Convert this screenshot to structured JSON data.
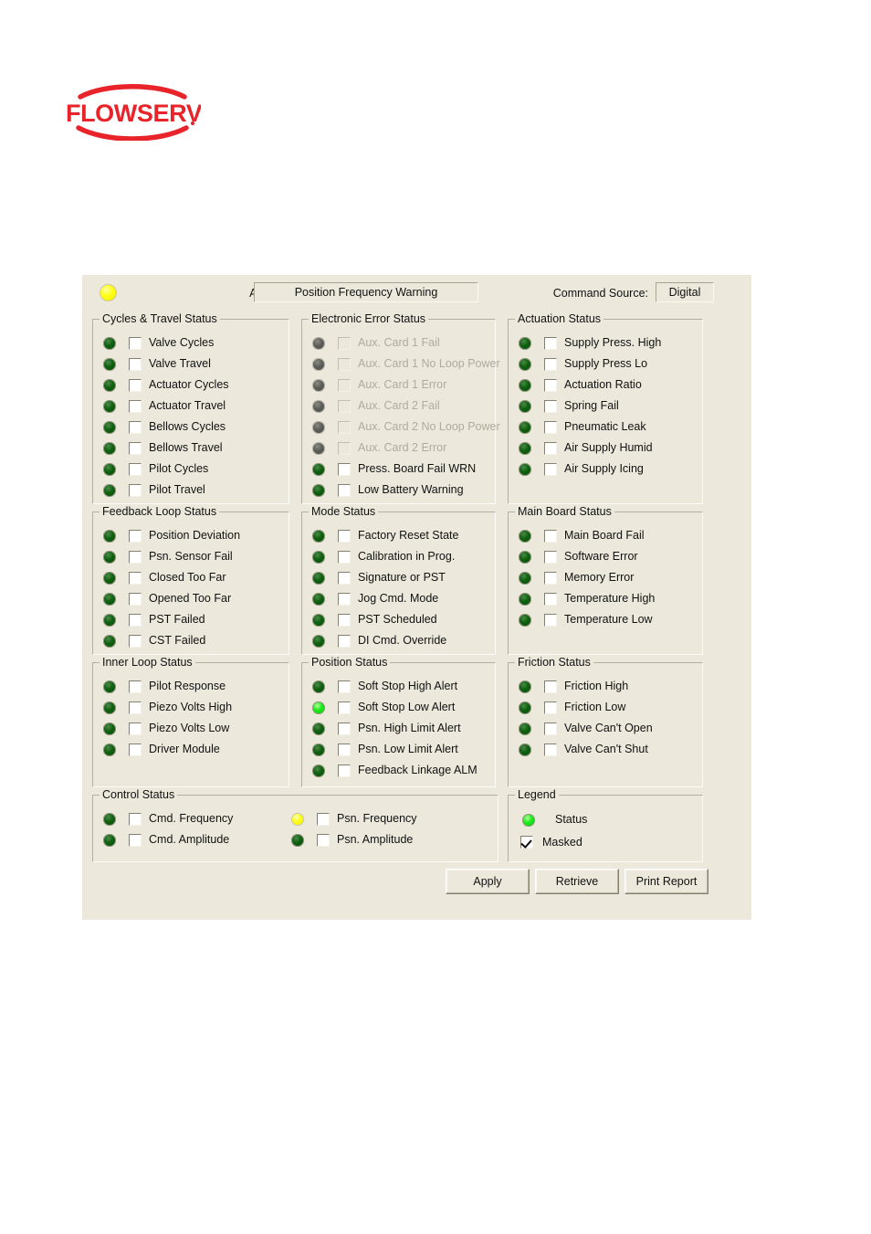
{
  "brand": {
    "name": "FLOWSERVE",
    "color": "#e8232a"
  },
  "header": {
    "active_indicator_label": "Active Indicator:",
    "active_indicator_value": "Position Frequency Warning",
    "command_source_label": "Command Source:",
    "command_source_value": "Digital"
  },
  "legend_colors": {
    "led_off": "#0f6010",
    "led_on": "#1bea1b",
    "led_warning": "#ffff14",
    "led_disabled": "#5c5c58",
    "panel_background": "#ece8dc"
  },
  "groups": [
    {
      "id": "cycles-travel-status",
      "title": "Cycles & Travel Status",
      "items": [
        {
          "label": "Valve Cycles",
          "led": "off",
          "checked": false,
          "disabled": false
        },
        {
          "label": "Valve Travel",
          "led": "off",
          "checked": false,
          "disabled": false
        },
        {
          "label": "Actuator Cycles",
          "led": "off",
          "checked": false,
          "disabled": false
        },
        {
          "label": "Actuator Travel",
          "led": "off",
          "checked": false,
          "disabled": false
        },
        {
          "label": "Bellows Cycles",
          "led": "off",
          "checked": false,
          "disabled": false
        },
        {
          "label": "Bellows Travel",
          "led": "off",
          "checked": false,
          "disabled": false
        },
        {
          "label": "Pilot Cycles",
          "led": "off",
          "checked": false,
          "disabled": false
        },
        {
          "label": "Pilot Travel",
          "led": "off",
          "checked": false,
          "disabled": false
        }
      ]
    },
    {
      "id": "electronic-error-status",
      "title": "Electronic Error Status",
      "items": [
        {
          "label": "Aux. Card 1 Fail",
          "led": "dis",
          "checked": false,
          "disabled": true
        },
        {
          "label": "Aux. Card 1 No Loop Power",
          "led": "dis",
          "checked": false,
          "disabled": true
        },
        {
          "label": "Aux. Card 1 Error",
          "led": "dis",
          "checked": false,
          "disabled": true
        },
        {
          "label": "Aux. Card 2 Fail",
          "led": "dis",
          "checked": false,
          "disabled": true
        },
        {
          "label": "Aux. Card 2 No Loop Power",
          "led": "dis",
          "checked": false,
          "disabled": true
        },
        {
          "label": "Aux. Card 2 Error",
          "led": "dis",
          "checked": false,
          "disabled": true
        },
        {
          "label": "Press. Board Fail WRN",
          "led": "off",
          "checked": false,
          "disabled": false
        },
        {
          "label": "Low Battery Warning",
          "led": "off",
          "checked": false,
          "disabled": false
        }
      ]
    },
    {
      "id": "actuation-status",
      "title": "Actuation Status",
      "items": [
        {
          "label": "Supply Press. High",
          "led": "off",
          "checked": false,
          "disabled": false
        },
        {
          "label": "Supply Press Lo",
          "led": "off",
          "checked": false,
          "disabled": false
        },
        {
          "label": "Actuation Ratio",
          "led": "off",
          "checked": false,
          "disabled": false
        },
        {
          "label": "Spring Fail",
          "led": "off",
          "checked": false,
          "disabled": false
        },
        {
          "label": "Pneumatic Leak",
          "led": "off",
          "checked": false,
          "disabled": false
        },
        {
          "label": "Air Supply Humid",
          "led": "off",
          "checked": false,
          "disabled": false
        },
        {
          "label": "Air Supply Icing",
          "led": "off",
          "checked": false,
          "disabled": false
        }
      ]
    },
    {
      "id": "feedback-loop-status",
      "title": "Feedback Loop Status",
      "items": [
        {
          "label": "Position Deviation",
          "led": "off",
          "checked": false,
          "disabled": false
        },
        {
          "label": "Psn. Sensor Fail",
          "led": "off",
          "checked": false,
          "disabled": false
        },
        {
          "label": "Closed Too Far",
          "led": "off",
          "checked": false,
          "disabled": false
        },
        {
          "label": "Opened Too Far",
          "led": "off",
          "checked": false,
          "disabled": false
        },
        {
          "label": "PST Failed",
          "led": "off",
          "checked": false,
          "disabled": false
        },
        {
          "label": "CST Failed",
          "led": "off",
          "checked": false,
          "disabled": false
        }
      ]
    },
    {
      "id": "mode-status",
      "title": "Mode Status",
      "items": [
        {
          "label": "Factory Reset State",
          "led": "off",
          "checked": false,
          "disabled": false
        },
        {
          "label": "Calibration in Prog.",
          "led": "off",
          "checked": false,
          "disabled": false
        },
        {
          "label": "Signature or PST",
          "led": "off",
          "checked": false,
          "disabled": false
        },
        {
          "label": "Jog Cmd. Mode",
          "led": "off",
          "checked": false,
          "disabled": false
        },
        {
          "label": "PST Scheduled",
          "led": "off",
          "checked": false,
          "disabled": false
        },
        {
          "label": "DI Cmd. Override",
          "led": "off",
          "checked": false,
          "disabled": false
        }
      ]
    },
    {
      "id": "main-board-status",
      "title": "Main Board Status",
      "items": [
        {
          "label": "Main Board Fail",
          "led": "off",
          "checked": false,
          "disabled": false
        },
        {
          "label": "Software Error",
          "led": "off",
          "checked": false,
          "disabled": false
        },
        {
          "label": "Memory Error",
          "led": "off",
          "checked": false,
          "disabled": false
        },
        {
          "label": "Temperature High",
          "led": "off",
          "checked": false,
          "disabled": false
        },
        {
          "label": "Temperature Low",
          "led": "off",
          "checked": false,
          "disabled": false
        }
      ]
    },
    {
      "id": "inner-loop-status",
      "title": "Inner Loop Status",
      "items": [
        {
          "label": "Pilot Response",
          "led": "off",
          "checked": false,
          "disabled": false
        },
        {
          "label": "Piezo Volts High",
          "led": "off",
          "checked": false,
          "disabled": false
        },
        {
          "label": "Piezo Volts Low",
          "led": "off",
          "checked": false,
          "disabled": false
        },
        {
          "label": "Driver Module",
          "led": "off",
          "checked": false,
          "disabled": false
        }
      ]
    },
    {
      "id": "position-status",
      "title": "Position Status",
      "items": [
        {
          "label": "Soft Stop High Alert",
          "led": "off",
          "checked": false,
          "disabled": false
        },
        {
          "label": "Soft Stop Low Alert",
          "led": "on",
          "checked": false,
          "disabled": false
        },
        {
          "label": "Psn. High Limit Alert",
          "led": "off",
          "checked": false,
          "disabled": false
        },
        {
          "label": "Psn. Low Limit Alert",
          "led": "off",
          "checked": false,
          "disabled": false
        },
        {
          "label": "Feedback Linkage ALM",
          "led": "off",
          "checked": false,
          "disabled": false
        }
      ]
    },
    {
      "id": "friction-status",
      "title": "Friction Status",
      "items": [
        {
          "label": "Friction High",
          "led": "off",
          "checked": false,
          "disabled": false
        },
        {
          "label": "Friction Low",
          "led": "off",
          "checked": false,
          "disabled": false
        },
        {
          "label": "Valve Can't Open",
          "led": "off",
          "checked": false,
          "disabled": false
        },
        {
          "label": "Valve Can't Shut",
          "led": "off",
          "checked": false,
          "disabled": false
        }
      ]
    }
  ],
  "control_status": {
    "id": "control-status",
    "title": "Control Status",
    "left_items": [
      {
        "label": "Cmd. Frequency",
        "led": "off",
        "checked": false,
        "disabled": false
      },
      {
        "label": "Cmd. Amplitude",
        "led": "off",
        "checked": false,
        "disabled": false
      }
    ],
    "right_items": [
      {
        "label": "Psn. Frequency",
        "led": "warn",
        "checked": false,
        "disabled": false
      },
      {
        "label": "Psn. Amplitude",
        "led": "off",
        "checked": false,
        "disabled": false
      }
    ]
  },
  "legend": {
    "title": "Legend",
    "status_label": "Status",
    "status_led": "on",
    "masked_label": "Masked",
    "masked_checked": true
  },
  "buttons": {
    "apply": "Apply",
    "retrieve": "Retrieve",
    "print_report": "Print Report"
  }
}
